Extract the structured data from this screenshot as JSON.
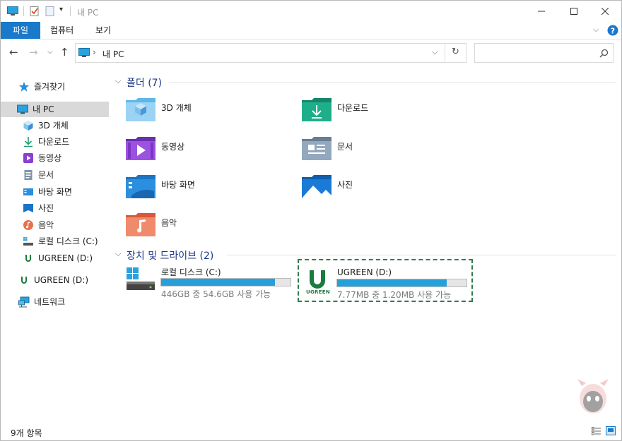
{
  "window": {
    "title": "내 PC"
  },
  "ribbon": {
    "tabs": [
      "파일",
      "컴퓨터",
      "보기"
    ]
  },
  "address": {
    "path": "내 PC",
    "search_placeholder": ""
  },
  "sidebar": {
    "items": [
      {
        "label": "즐겨찾기"
      },
      {
        "label": "내 PC"
      },
      {
        "label": "3D 개체"
      },
      {
        "label": "다운로드"
      },
      {
        "label": "동영상"
      },
      {
        "label": "문서"
      },
      {
        "label": "바탕 화면"
      },
      {
        "label": "사진"
      },
      {
        "label": "음악"
      },
      {
        "label": "로컬 디스크 (C:)"
      },
      {
        "label": "UGREEN (D:)"
      },
      {
        "label": "UGREEN (D:)"
      },
      {
        "label": "네트워크"
      }
    ]
  },
  "folders_group": {
    "title": "폴더 (7)"
  },
  "folders": [
    "3D 개체",
    "다운로드",
    "동영상",
    "문서",
    "바탕 화면",
    "사진",
    "음악"
  ],
  "drives_group": {
    "title": "장치 및 드라이브 (2)"
  },
  "drives": [
    {
      "name": "로컬 디스크 (C:)",
      "free_text": "446GB 중 54.6GB 사용 가능",
      "used_fraction": 0.878
    },
    {
      "name": "UGREEN (D:)",
      "free_text": "7.77MB 중 1.20MB 사용 가능",
      "used_fraction": 0.846,
      "logo_text": "UGREEN"
    }
  ],
  "status": {
    "count": "9개 항목"
  },
  "colors": {
    "accent": "#1979ca",
    "bar_fill": "#26a0da",
    "highlight": "#2e7d4f"
  }
}
